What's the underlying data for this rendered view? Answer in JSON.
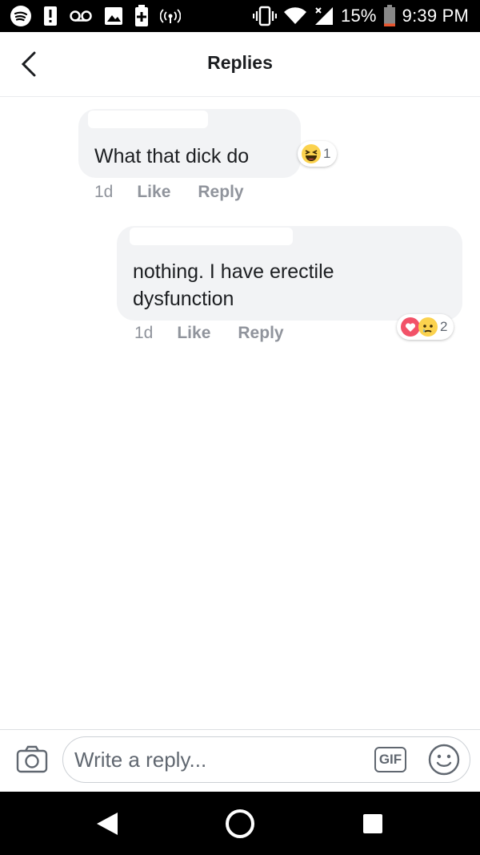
{
  "status_bar": {
    "battery_percent": "15%",
    "time": "9:39 PM",
    "icons": [
      "spotify-icon",
      "alert-icon",
      "voicemail-icon",
      "image-icon",
      "battery-saver-icon",
      "hotspot-icon",
      "vibrate-icon",
      "wifi-icon",
      "signal-icon",
      "battery-icon"
    ],
    "battery_level": 0.15,
    "battery_color": "#e8542d"
  },
  "header": {
    "title": "Replies",
    "back_icon": "chevron-left-icon"
  },
  "comments": [
    {
      "text": "What that dick do",
      "time": "1d",
      "like_label": "Like",
      "reply_label": "Reply",
      "reactions": [
        "haha"
      ],
      "reaction_count": "1"
    },
    {
      "text_line1": "nothing. I have erectile",
      "text_line2": "dysfunction",
      "time": "1d",
      "like_label": "Like",
      "reply_label": "Reply",
      "reactions": [
        "love",
        "sad"
      ],
      "reaction_count": "2"
    }
  ],
  "composer": {
    "placeholder": "Write a reply...",
    "gif_label": "GIF",
    "camera_icon": "camera-icon",
    "emoji_icon": "smiley-icon"
  },
  "nav_bar": {
    "icons": [
      "back-triangle-icon",
      "home-circle-icon",
      "overview-square-icon"
    ]
  },
  "colors": {
    "bubble": "#f2f3f5",
    "meta_text": "#90949c",
    "love": "#f25268",
    "emoji_yellow": "#fbd24e"
  }
}
